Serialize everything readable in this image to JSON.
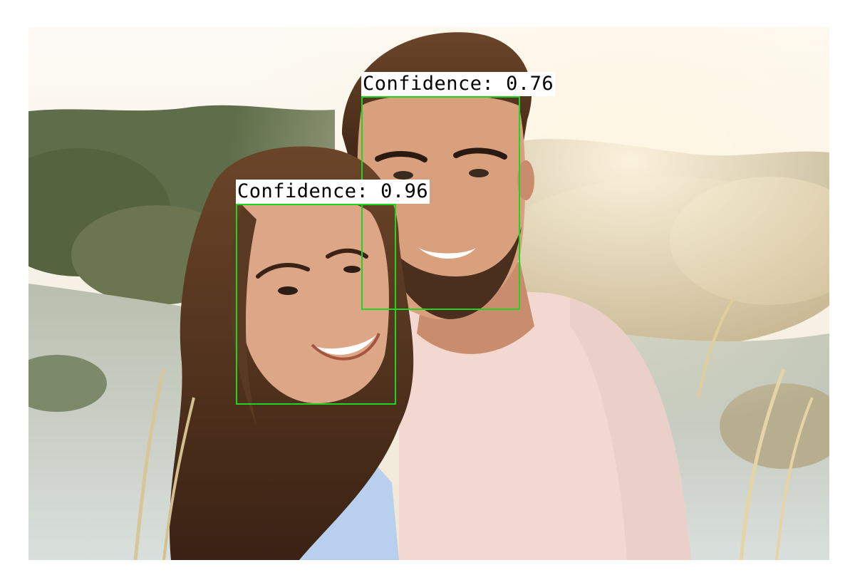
{
  "image": {
    "subject": "photo",
    "colors": {
      "sky": "#fbf6ee",
      "foliage": "#6f7a55",
      "sand": "#c8cfc9",
      "hair": "#4a2d1c",
      "skin": "#d9a07e",
      "shirt_left": "#b9d0ee",
      "shirt_right": "#f3d9d2"
    }
  },
  "detections": [
    {
      "label": "Confidence: 0.76",
      "score": 0.76,
      "box_color": "#1fd51f"
    },
    {
      "label": "Confidence: 0.96",
      "score": 0.96,
      "box_color": "#1fd51f"
    }
  ]
}
